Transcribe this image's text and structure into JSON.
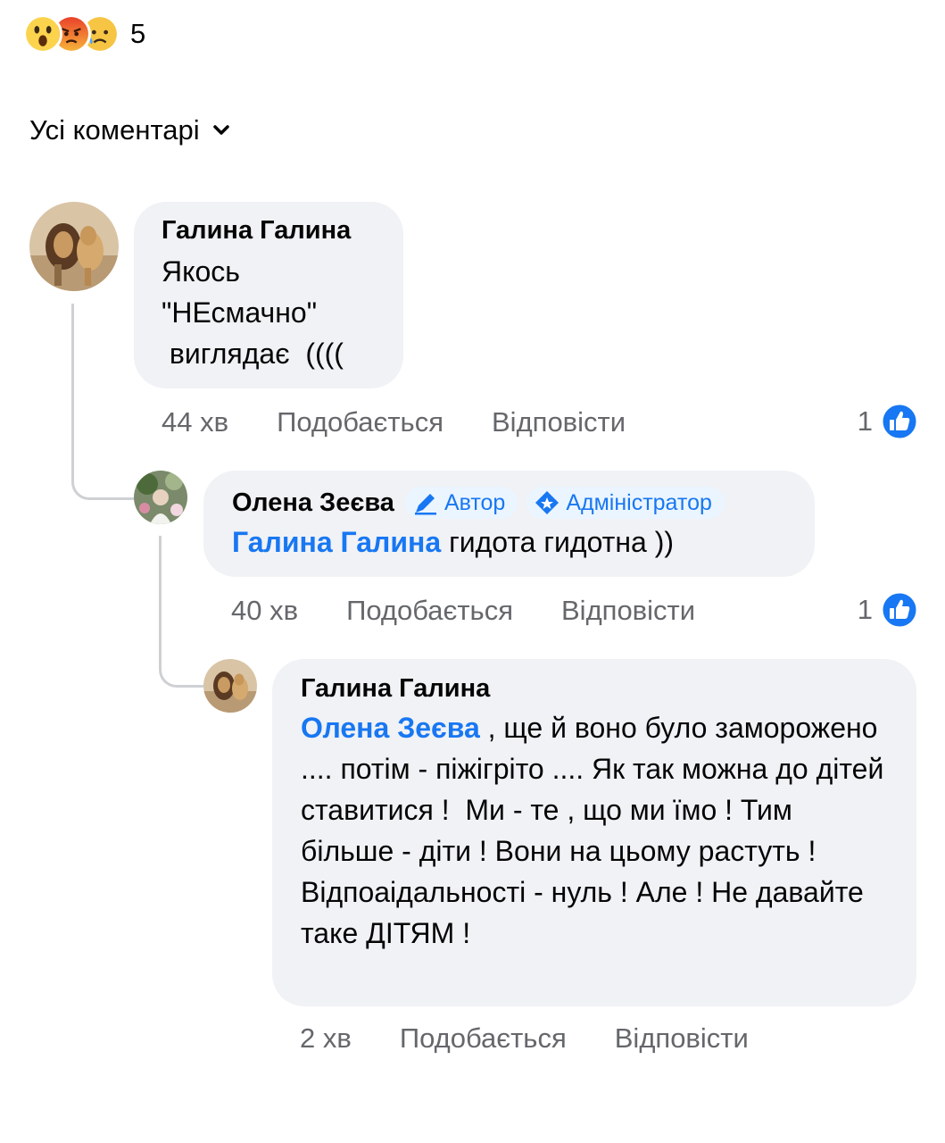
{
  "reactions": {
    "icons": [
      "wow-reaction-icon",
      "angry-reaction-icon",
      "sad-reaction-icon"
    ],
    "count": "5"
  },
  "filter": {
    "label": "Усі коментарі",
    "icon": "chevron-down-icon"
  },
  "colors": {
    "link": "#1877f2",
    "bubble": "#f0f2f5",
    "meta": "#65676b"
  },
  "comments": [
    {
      "author": "Галина Галина",
      "text": "Якось\n\"НЕсмачно\"\n виглядає  ((((",
      "time": "44 хв",
      "like_label": "Подобається",
      "reply_label": "Відповісти",
      "like_count": "1"
    },
    {
      "author": "Олена Зеєва",
      "badges": [
        "Автор",
        "Адміністратор"
      ],
      "mention": "Галина Галина",
      "text": " гидота гидотна ))",
      "time": "40 хв",
      "like_label": "Подобається",
      "reply_label": "Відповісти",
      "like_count": "1"
    },
    {
      "author": "Галина Галина",
      "mention": "Олена Зеєва",
      "text": " , ще й воно було заморожено .... потім - піжігріто .... Як так можна до дітей ставитися !  Ми - те , що ми їмо ! Тим більше - діти ! Вони на цьому растуть ! Відпоаідальності - нуль ! Але ! Не давайте таке ДІТЯМ !",
      "time": "2 хв",
      "like_label": "Подобається",
      "reply_label": "Відповісти"
    }
  ]
}
